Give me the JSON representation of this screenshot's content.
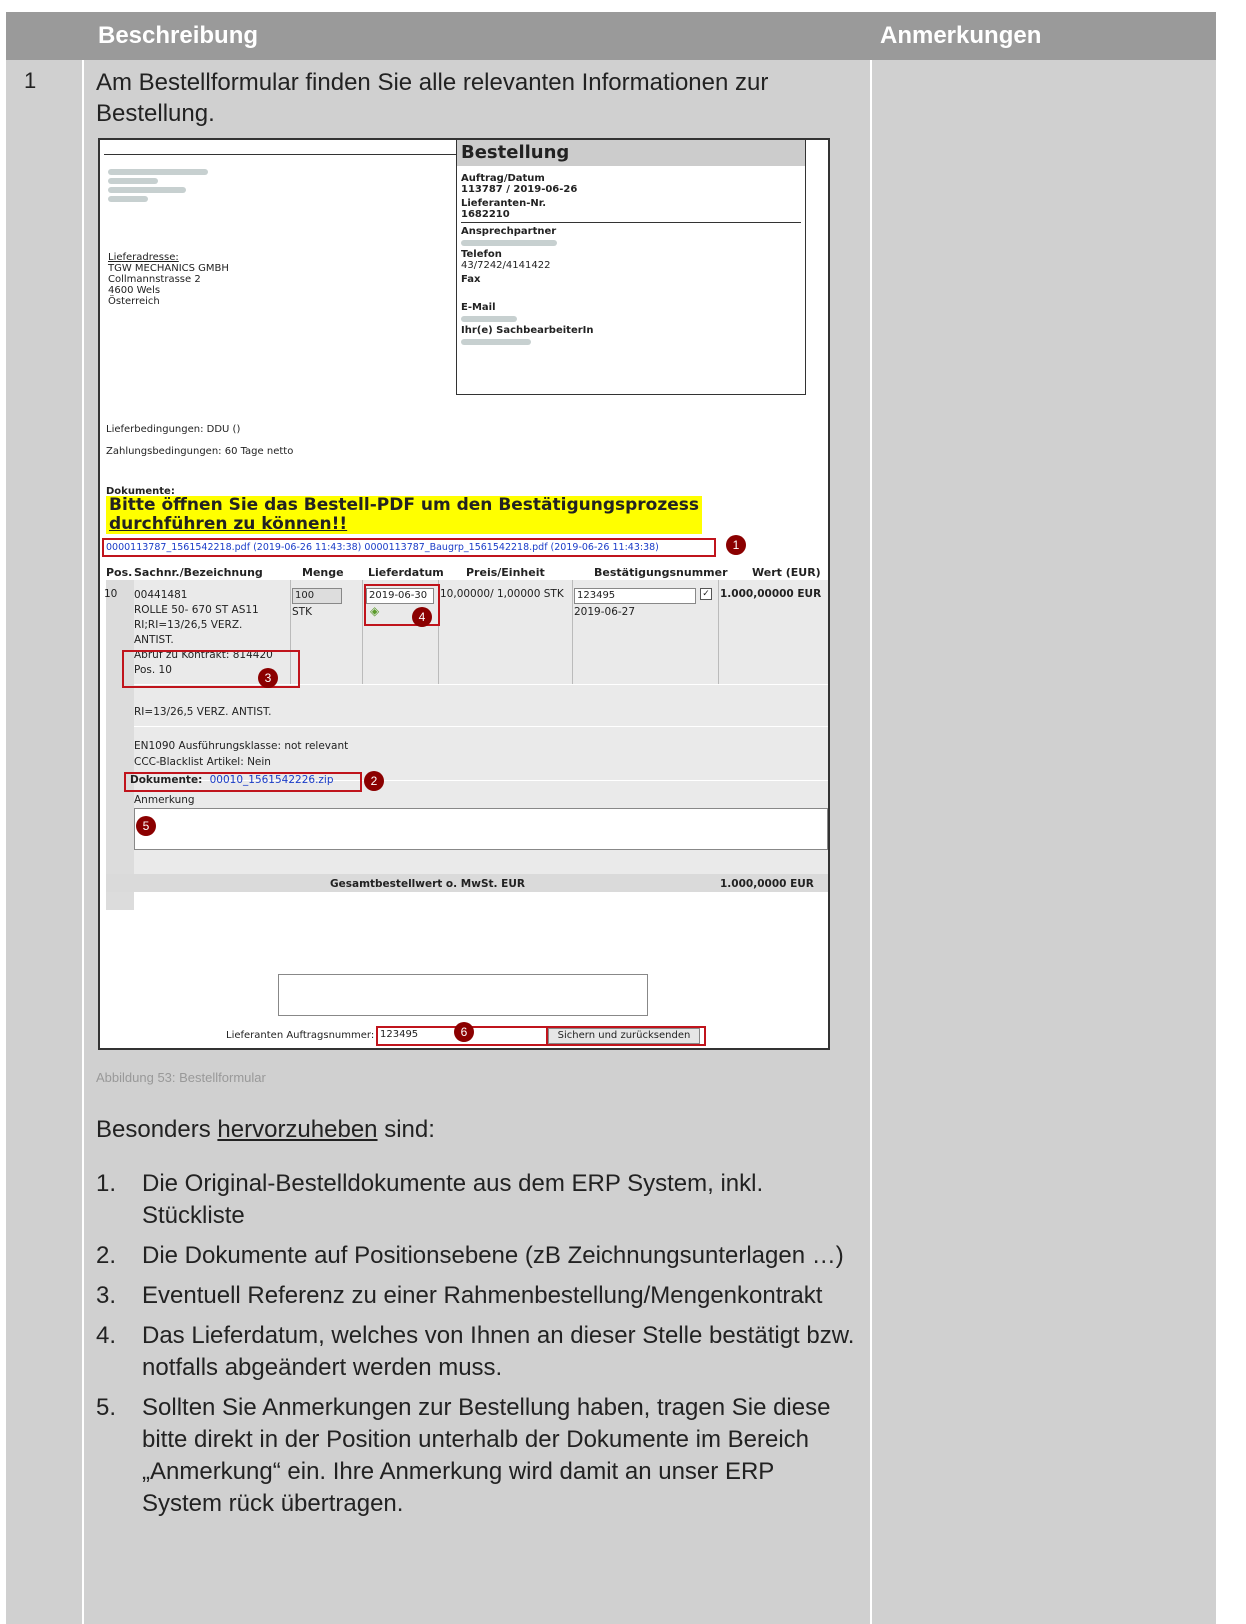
{
  "table": {
    "header_desc": "Beschreibung",
    "header_notes": "Anmerkungen",
    "row_number": "1",
    "intro_line1": "Am Bestellformular finden Sie alle relevanten Informationen zur",
    "intro_line2": "Bestellung."
  },
  "form": {
    "title": "Bestellung",
    "auftrag_label": "Auftrag/Datum",
    "auftrag_value": "113787 / 2019-06-26",
    "lieferanten_nr_label": "Lieferanten-Nr.",
    "lieferanten_nr_value": "1682210",
    "ansprechpartner_label": "Ansprechpartner",
    "telefon_label": "Telefon",
    "telefon_value": "43/7242/4141422",
    "fax_label": "Fax",
    "email_label": "E-Mail",
    "sachbearbeiter_label": "Ihr(e) SachbearbeiterIn",
    "lieferadresse_label": "Lieferadresse:",
    "lieferadresse_lines": [
      "TGW MECHANICS GMBH",
      "Collmannstrasse 2",
      "4600 Wels",
      "Österreich"
    ],
    "lieferbedingungen": "Lieferbedingungen: DDU ()",
    "zahlungsbedingungen": "Zahlungsbedingungen: 60 Tage netto",
    "dokumente_label": "Dokumente:",
    "warning_line1": "Bitte öffnen Sie das Bestell-PDF um den Bestätigungsprozess",
    "warning_line2": "durchführen zu können!!",
    "pdf_links": "0000113787_1561542218.pdf (2019-06-26 11:43:38)  0000113787_Baugrp_1561542218.pdf (2019-06-26 11:43:38)",
    "columns": [
      "Pos.",
      "Sachnr./Bezeichnung",
      "Menge",
      "Lieferdatum",
      "Preis/Einheit",
      "Bestätigungsnummer",
      "Wert (EUR)"
    ],
    "pos": "10",
    "sachnr": "00441481",
    "bezeichnung_lines": [
      "ROLLE 50- 670 ST AS11",
      "RI;RI=13/26,5 VERZ.",
      "ANTIST."
    ],
    "abruf": "Abruf zu Kontrakt:  814420",
    "abruf_pos": "Pos. 10",
    "menge_value": "100",
    "menge_unit": "STK",
    "lieferdatum_value": "2019-06-30",
    "preis": "10,00000/ 1,00000 STK",
    "bestaetigung_value": "123495",
    "bestaetigung_date": "2019-06-27",
    "wert": "1.000,00000 EUR",
    "ri_text": "RI=13/26,5 VERZ. ANTIST.",
    "en1090": "EN1090 Ausführungsklasse: not relevant",
    "ccc": "CCC-Blacklist Artikel: Nein",
    "pos_dokumente_label": "Dokumente:",
    "pos_dokumente_link": "00010_1561542226.zip",
    "anmerkung_label": "Anmerkung",
    "gesamt_label": "Gesamtbestellwert o. MwSt. EUR",
    "gesamt_value": "1.000,0000 EUR",
    "auftragsnr_label": "Lieferanten Auftragsnummer:",
    "auftragsnr_value": "123495",
    "submit_button": "Sichern und zurücksenden",
    "badges": [
      "1",
      "2",
      "3",
      "4",
      "5",
      "6"
    ]
  },
  "caption": "Abbildung 53: Bestellformular",
  "highlight": {
    "prefix": "Besonders ",
    "underlined": "hervorzuheben",
    "suffix": " sind:"
  },
  "items": [
    {
      "n": "1.",
      "text": "Die Original-Bestelldokumente aus dem ERP System, inkl. Stückliste"
    },
    {
      "n": "2.",
      "text": "Die Dokumente auf Positionsebene (zB Zeichnungsunterlagen …)"
    },
    {
      "n": "3.",
      "text": "Eventuell Referenz zu einer Rahmenbestellung/Mengenkontrakt"
    },
    {
      "n": "4.",
      "text": "Das Lieferdatum, welches von Ihnen an dieser Stelle bestätigt bzw. notfalls abgeändert werden muss."
    },
    {
      "n": "5.",
      "text": "Sollten Sie Anmerkungen zur Bestellung haben, tragen Sie diese bitte direkt in der Position unterhalb der Dokumente im Bereich „Anmerkung“ ein. Ihre Anmerkung wird damit an unser ERP System rück übertragen."
    }
  ]
}
